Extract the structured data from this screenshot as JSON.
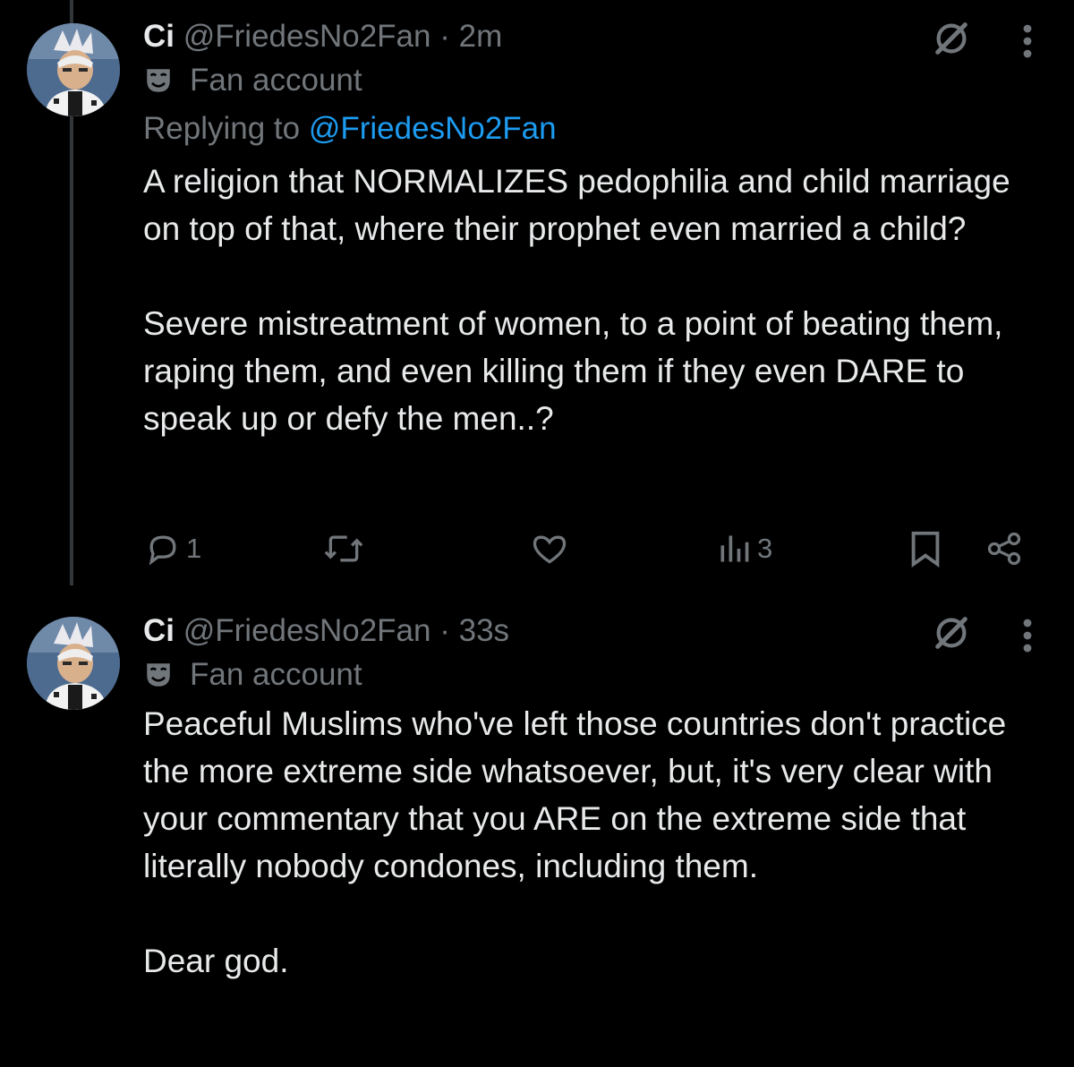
{
  "tweets": [
    {
      "display_name": "Ci",
      "handle": "@FriedesNo2Fan",
      "separator": "·",
      "time": "2m",
      "label": "Fan account",
      "replying_prefix": "Replying to",
      "replying_handle": "@FriedesNo2Fan",
      "paragraphs": [
        "A religion that NORMALIZES pedophilia and child marriage on top of that, where their prophet even married a child?",
        "Severe mistreatment of women, to a point of beating them, raping them, and even killing them if they even DARE to speak up or defy the men..?"
      ],
      "stats": {
        "replies": "1",
        "views": "3"
      },
      "icons": [
        "grok-icon",
        "more-icon",
        "mask-icon",
        "reply-icon",
        "retweet-icon",
        "like-icon",
        "views-icon",
        "bookmark-icon",
        "share-icon"
      ]
    },
    {
      "display_name": "Ci",
      "handle": "@FriedesNo2Fan",
      "separator": "·",
      "time": "33s",
      "label": "Fan account",
      "paragraphs": [
        "Peaceful Muslims who've left those countries don't practice the more extreme side whatsoever, but, it's very clear with your commentary that you ARE on the extreme side that literally nobody condones, including them.",
        "Dear god."
      ]
    }
  ],
  "colors": {
    "background": "#000000",
    "text": "#e7e9ea",
    "secondary": "#71767b",
    "link": "#1d9bf0",
    "thread_line": "#333639"
  }
}
